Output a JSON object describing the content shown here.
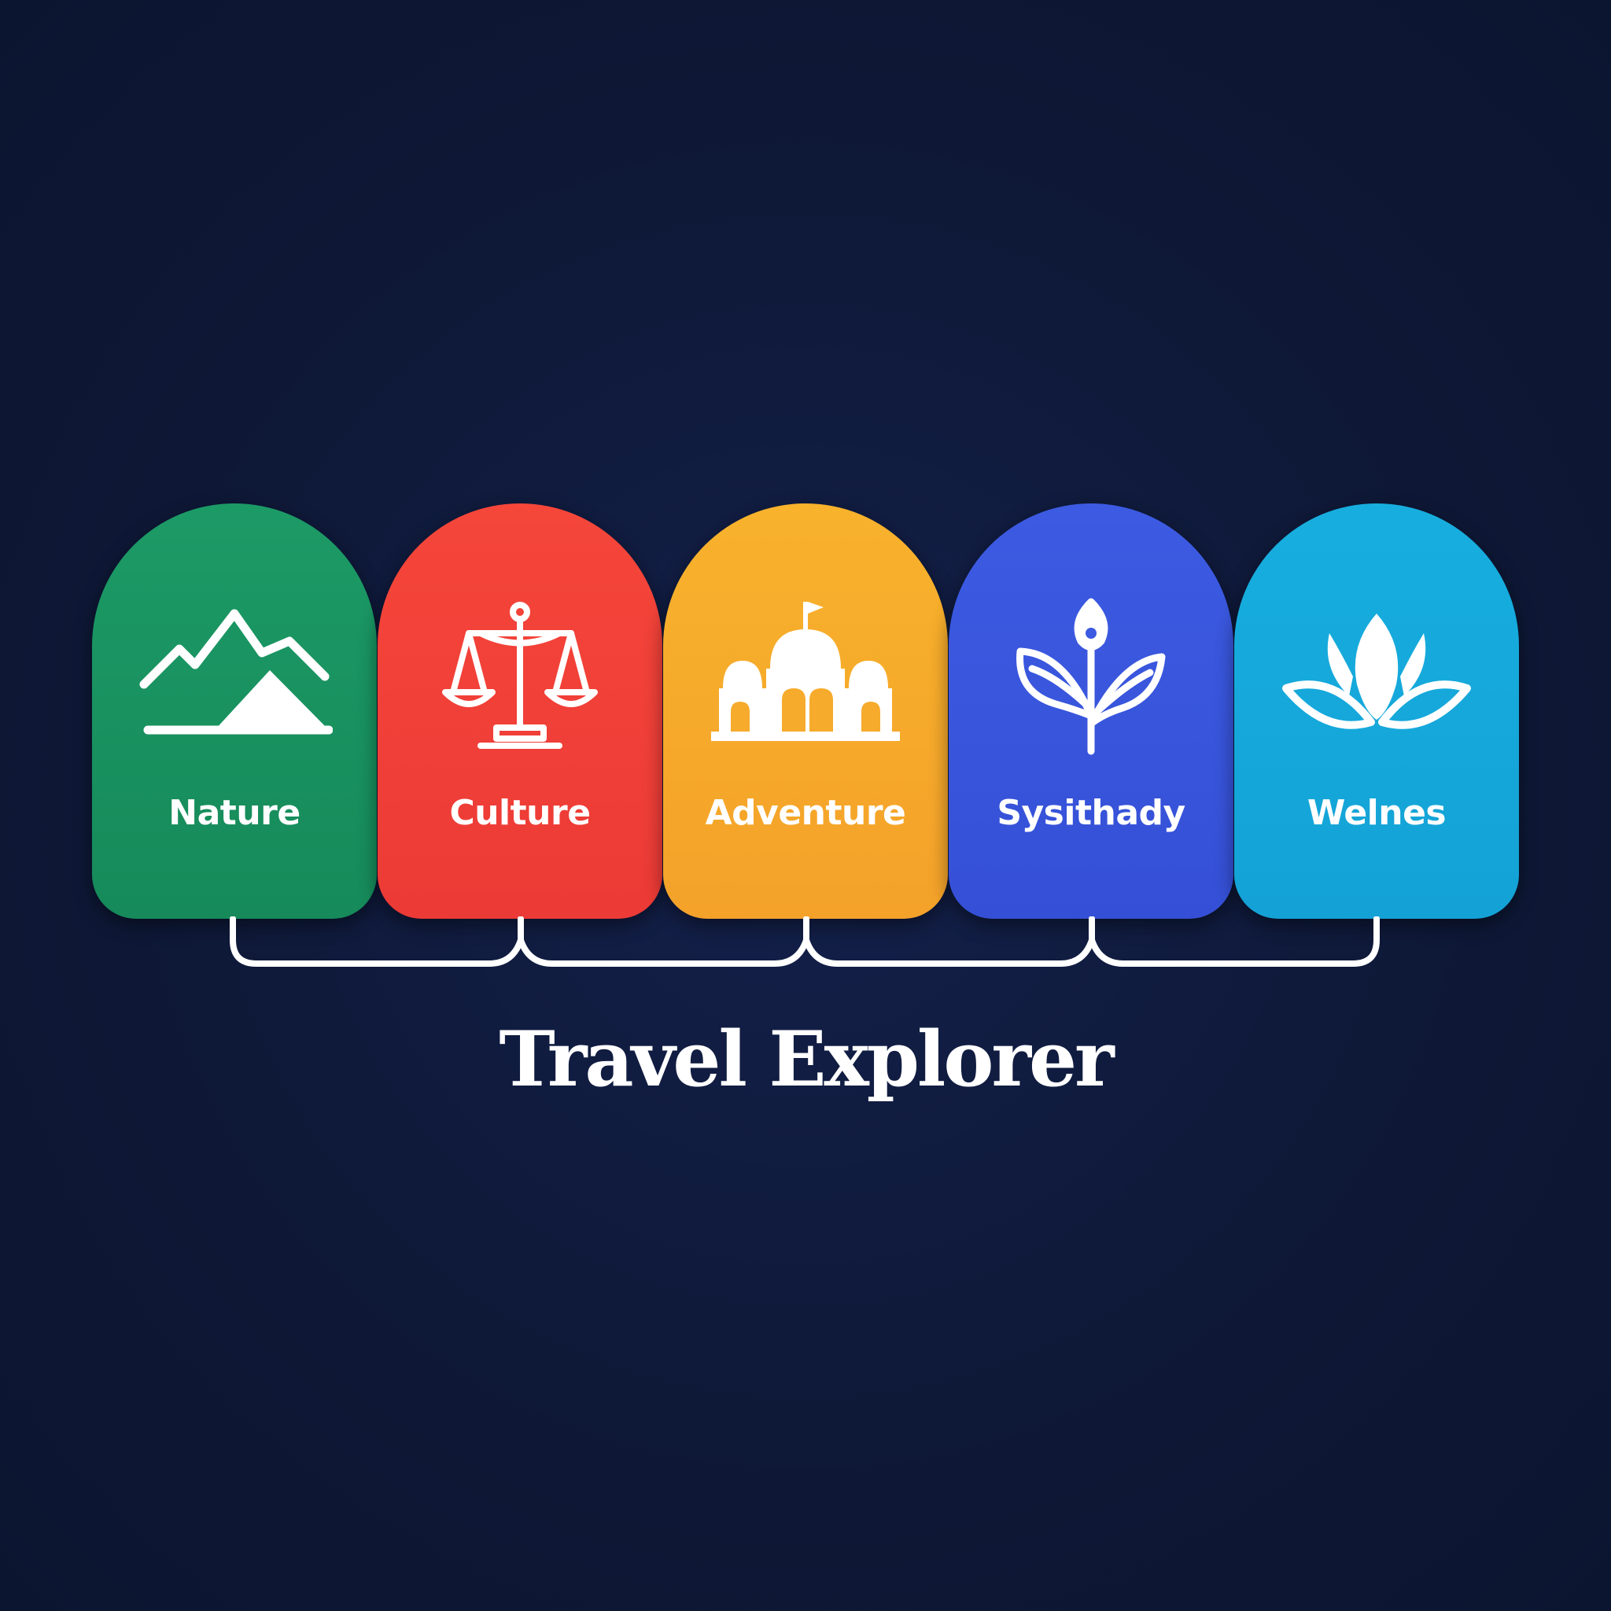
{
  "title": "Travel Explorer",
  "categories": [
    {
      "label": "Nature",
      "icon": "mountain-icon",
      "color": "#1a9463"
    },
    {
      "label": "Culture",
      "icon": "scales-icon",
      "color": "#f2403a"
    },
    {
      "label": "Adventure",
      "icon": "domed-building-icon",
      "color": "#f6ab2c"
    },
    {
      "label": "Sysithady",
      "icon": "sprout-icon",
      "color": "#3b5ae0"
    },
    {
      "label": "Welnes",
      "icon": "lotus-icon",
      "color": "#16a9dc"
    }
  ]
}
